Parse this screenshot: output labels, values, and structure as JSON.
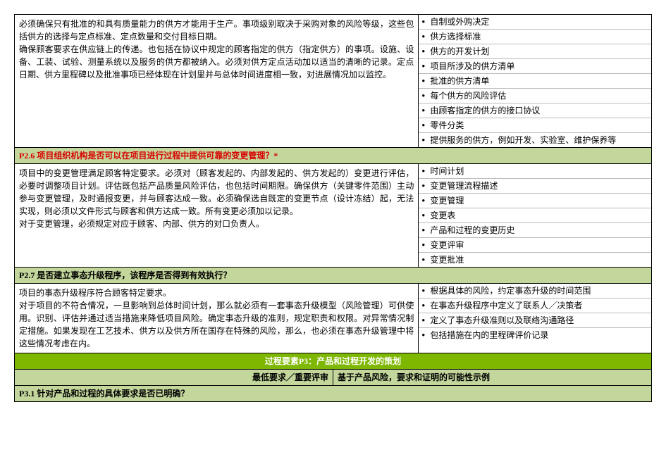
{
  "section1": {
    "left_text": "必须确保只有批准的和具有质量能力的供方才能用于生产。事项级别取决于采购对象的风险等级，这些包括供方的选择与定点标准、定点数量和交付目标日期。\n确保顾客要求在供应链上的传递。也包括在协议中规定的顾客指定的供方（指定供方）的事项。设施、设备、工装、试验、测量系统以及服务的供方都被纳入。必须对供方定点活动加以适当的清晰的记录。定点日期、供方里程碑以及批准事项已经体现在计划里并与总体时间进度相一致，对进展情况加以监控。",
    "right_items": [
      "自制或外购决定",
      "供方选择标准",
      "供方的开发计划",
      "项目所涉及的供方清单",
      "批准的供方清单",
      "每个供方的风险评估",
      "由顾客指定的供方的接口协议",
      "零件分类",
      "提供服务的供方，例如开发、实验室、维护保养等"
    ]
  },
  "p26": {
    "heading": "P2.6  项目组织机构是否可以在项目进行过程中提供可靠的变更管理？*",
    "left_text": "项目中的变更管理满足顾客特定要求。必须对（顾客发起的、内部发起的、供方发起的）变更进行评估，必要时调整项目计划。评估既包括产品质量风险评估，也包括时间期限。确保供方（关键零件范围）主动参与变更管理，及时通报变更，并与顾客达成一致。必须确保选自既定的变更节点（设计冻结）起，无法实现，则必须以文件形式与顾客和供方达成一致。所有变更必须加以记录。\n对于变更管理，必须规定对应于顾客、内部、供方的对口负责人。",
    "right_items": [
      "时间计划",
      "变更管理流程描述",
      "变更管理",
      "变更表",
      "产品和过程的变更历史",
      "变更评审",
      "变更批准"
    ]
  },
  "p27": {
    "heading": "P2.7  是否建立事态升级程序，该程序是否得到有效执行？",
    "left_text": "项目的事态升级程序符合顾客特定要求。\n对于项目的不符合情况，一旦影响到总体时间计划，那么就必须有一套事态升级模型（风险管理）可供使用。识别、评估并通过适当措施来降低项目风险。确定事态升级的准则，规定职责和权限。对异常情况制定措施。如果发现在工艺技术、供方以及供方所在国存在特殊的风险，那么，也必须在事态升级管理中将这些情况考虑在内。",
    "right_items": [
      "根据具体的风险，约定事态升级的时间范围",
      "在事态升级程序中定义了联系人／决策者",
      "定义了事态升级准则以及联络沟通路径",
      "包括措施在内的里程碑评价记录"
    ]
  },
  "p3": {
    "banner": "过程要素P3：产品和过程开发的策划",
    "left_label": "最低要求／重要评审",
    "right_label": "基于产品风险，要求和证明的可能性示例"
  },
  "p31": {
    "heading": "P3.1  针对产品和过程的具体要求是否已明确？"
  }
}
